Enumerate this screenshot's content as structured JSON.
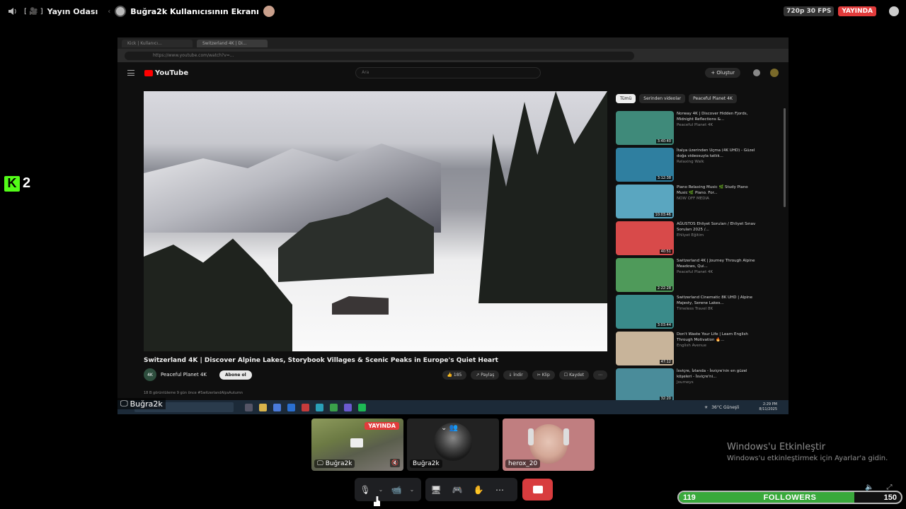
{
  "topbar": {
    "room_badge": "[ 🎥 ]",
    "room_name": "Yayın Odası",
    "screen_label": "Buğra2k Kullanıcısının Ekranı",
    "quality": "720p 30 FPS",
    "live": "YAYINDA"
  },
  "overlay": {
    "k2_number": "2"
  },
  "browser": {
    "tabs": [
      "Kick | Kullanıcı...",
      "Switzerland 4K | Di..."
    ],
    "url": "https://www.youtube.com/watch?v=..."
  },
  "youtube": {
    "logo": "YouTube",
    "search_placeholder": "Ara",
    "create_label": "+ Oluştur",
    "video_title": "Switzerland 4K | Discover Alpine Lakes, Storybook Villages & Scenic Peaks in Europe's Quiet Heart",
    "channel_initials": "4K",
    "channel_name": "Peaceful Planet 4K",
    "subscribe_label": "Abone ol",
    "actions": [
      "👍 185",
      "↗ Paylaş",
      "↓ İndir",
      "✂ Klip",
      "☐ Kaydet",
      "⋯"
    ],
    "description_line": "18 B görüntüleme  9 gün önce  #SwitzerlandAlpsAutumn",
    "chips": [
      "Tümü",
      "Serinden videolar",
      "Peaceful Planet 4K"
    ],
    "recommendations": [
      {
        "title": "Norway 4K | Discover Hidden Fjords, Midnight Reflections &...",
        "meta": "Peaceful Planet 4K",
        "duration": "3:40:40",
        "color": "#3f8a7a"
      },
      {
        "title": "İtalya üzerinden Uçma (4K UHD) - Güzel doğa videosuyla tatlık...",
        "meta": "Relaxing Walk",
        "duration": "3:12:38",
        "color": "#2f7fa0"
      },
      {
        "title": "Piano Relaxing Music 🌿 Study Piano Music 🌿 Piano. For...",
        "meta": "NOW OFF MEDIA",
        "duration": "10:03:46",
        "color": "#5aa6c0"
      },
      {
        "title": "AĞUSTOS Ehliyet Soruları / Ehliyet Sınav Soruları 2025 /...",
        "meta": "Ehliyet Eğitim",
        "duration": "40:51",
        "color": "#d84a4a"
      },
      {
        "title": "Switzerland 4K | Journey Through Alpine Meadows, Qui...",
        "meta": "Peaceful Planet 4K",
        "duration": "2:22:28",
        "color": "#4f9a5a"
      },
      {
        "title": "Switzerland Cinematic 8K UHD | Alpine Majesty, Serene Lakes...",
        "meta": "Timeless Travel 8K",
        "duration": "3:03:44",
        "color": "#3a8b8a"
      },
      {
        "title": "Don't Waste Your Life | Learn English Through Motivation 🔥...",
        "meta": "English Avenue",
        "duration": "47:12",
        "color": "#c8b49a"
      },
      {
        "title": "İsviçre, İzlanda - İsviçre'nin en güzel köşeleri - İsviçre'ni...",
        "meta": "Journeys",
        "duration": "32:20",
        "color": "#4a8c9a"
      }
    ]
  },
  "taskbar": {
    "name_tag": "Buğra2k",
    "weather": "36°C  Güneşli",
    "time": "2:29 PM",
    "date": "8/11/2025"
  },
  "tiles": [
    {
      "name": "Buğra2k",
      "live": "YAYINDA"
    },
    {
      "name": "Buğra2k"
    },
    {
      "name": "herox_20"
    }
  ],
  "controls": {
    "mic": "🎙",
    "mic_menu": "⌄",
    "camera": "📹",
    "cam_menu": "⌄",
    "share": "🖥",
    "activity": "🎮",
    "soundboard": "✋",
    "more": "⋯"
  },
  "windows": {
    "activate_title": "Windows'u Etkinleştir",
    "activate_sub": "Windows'u etkinleştirmek için Ayarlar'a gidin."
  },
  "followers": {
    "current": "119",
    "label": "FOLLOWERS",
    "goal": "150",
    "progress": 0.79,
    "bar_color": "#39a93b"
  }
}
